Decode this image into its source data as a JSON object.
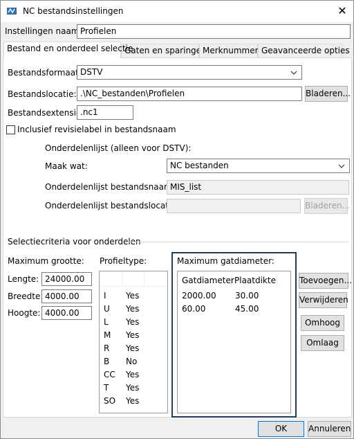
{
  "window": {
    "title": "NC bestandsinstellingen",
    "close_glyph": "✕",
    "app_icon": "nc-settings-icon"
  },
  "settings_name": {
    "label": "Instellingen naam:",
    "value": "Profielen"
  },
  "tabs": [
    {
      "label": "Bestand en onderdeel selectie",
      "active": true
    },
    {
      "label": "Gaten en sparingen",
      "active": false
    },
    {
      "label": "Merknummer",
      "active": false
    },
    {
      "label": "Geavanceerde opties",
      "active": false
    }
  ],
  "file": {
    "format_label": "Bestandsformaat:",
    "format_value": "DSTV",
    "location_label": "Bestandslocatie:",
    "location_value": ".\\NC_bestanden\\Profielen",
    "browse_label": "Bladeren...",
    "extension_label": "Bestandsextensie:",
    "extension_value": ".nc1",
    "revision_label": "Inclusief revisielabel in bestandsnaam",
    "revision_checked": false
  },
  "parts_list": {
    "heading": "Onderdelenlijst (alleen voor DSTV):",
    "make_label": "Maak wat:",
    "make_value": "NC bestanden",
    "filename_label": "Onderdelenlijst bestandsnaam:",
    "filename_value": "MIS_list",
    "location_label": "Onderdelenlijst bestandslocatie:",
    "location_value": "",
    "browse_label": "Bladeren..."
  },
  "criteria": {
    "heading": "Selectiecriteria voor onderdelen",
    "max_size_label": "Maximum grootte:",
    "length_label": "Lengte:",
    "length_value": "24000.00",
    "width_label": "Breedte:",
    "width_value": "4000.00",
    "height_label": "Hoogte:",
    "height_value": "4000.00",
    "profile_type_label": "Profieltype:",
    "profile_types": [
      {
        "code": "I",
        "value": "Yes"
      },
      {
        "code": "U",
        "value": "Yes"
      },
      {
        "code": "L",
        "value": "Yes"
      },
      {
        "code": "M",
        "value": "Yes"
      },
      {
        "code": "R",
        "value": "Yes"
      },
      {
        "code": "B",
        "value": "No"
      },
      {
        "code": "CC",
        "value": "Yes"
      },
      {
        "code": "T",
        "value": "Yes"
      },
      {
        "code": "SO",
        "value": "Yes"
      }
    ],
    "max_hole_label": "Maximum gatdiameter:",
    "hole_columns": [
      "Gatdiameter",
      "Plaatdikte"
    ],
    "hole_rows": [
      {
        "diameter": "2000.00",
        "thickness": "30.00"
      },
      {
        "diameter": "60.00",
        "thickness": "45.00"
      }
    ],
    "add_label": "Toevoegen...",
    "remove_label": "Verwijderen",
    "up_label": "Omhoog",
    "down_label": "Omlaag"
  },
  "footer": {
    "ok_label": "OK",
    "cancel_label": "Annuleren"
  },
  "colors": {
    "focus_border": "#1b3e64",
    "default_button_border": "#0078d7"
  }
}
